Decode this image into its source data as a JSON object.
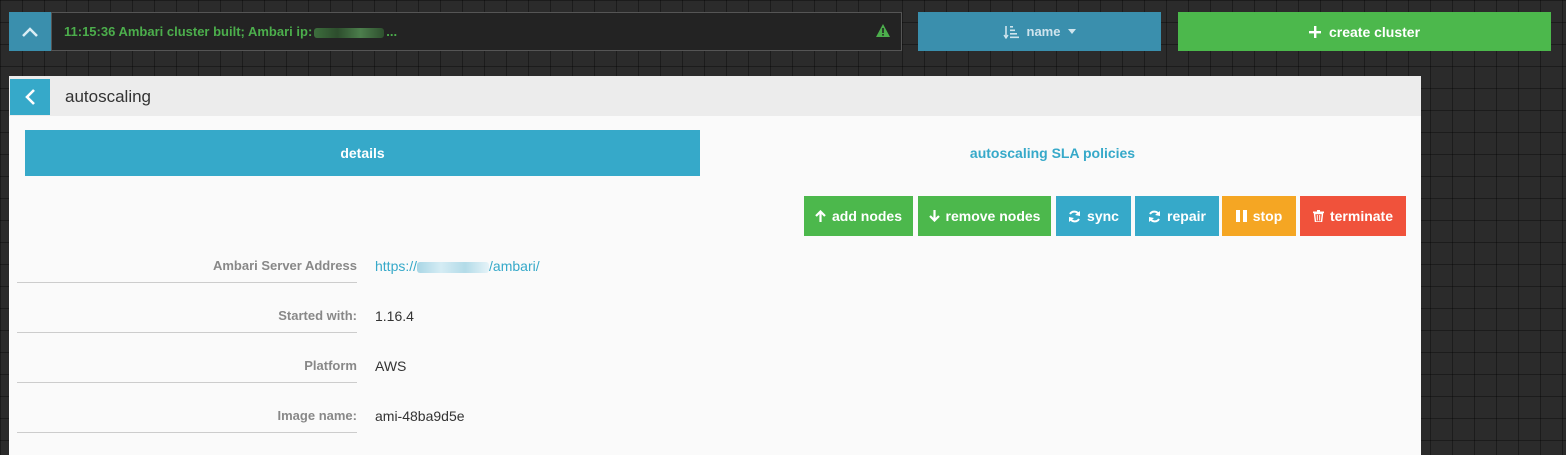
{
  "topbar": {
    "notification": {
      "prefix": "11:15:36 Ambari cluster built; Ambari ip:",
      "suffix": "..."
    },
    "sort_label": "name",
    "create_label": "create cluster"
  },
  "panel": {
    "title": "autoscaling",
    "tabs": [
      {
        "label": "details",
        "active": true
      },
      {
        "label": "autoscaling SLA policies",
        "active": false
      }
    ],
    "actions": {
      "add_nodes": "add nodes",
      "remove_nodes": "remove nodes",
      "sync": "sync",
      "repair": "repair",
      "stop": "stop",
      "terminate": "terminate"
    },
    "fields": [
      {
        "label": "Ambari Server Address",
        "value_prefix": "https://",
        "value_suffix": "/ambari/"
      },
      {
        "label": "Started with:",
        "value": "1.16.4"
      },
      {
        "label": "Platform",
        "value": "AWS"
      },
      {
        "label": "Image name:",
        "value": "ami-48ba9d5e"
      }
    ]
  },
  "colors": {
    "primary_blue": "#36a9c9",
    "success_green": "#4cb84c",
    "warning_orange": "#f5a623",
    "danger_red": "#f0523b"
  },
  "icons": {
    "collapse": "chevron-up-icon",
    "warning": "warning-triangle-icon",
    "sort": "sort-amount-icon",
    "back": "chevron-left-icon",
    "add": "plus-icon"
  }
}
